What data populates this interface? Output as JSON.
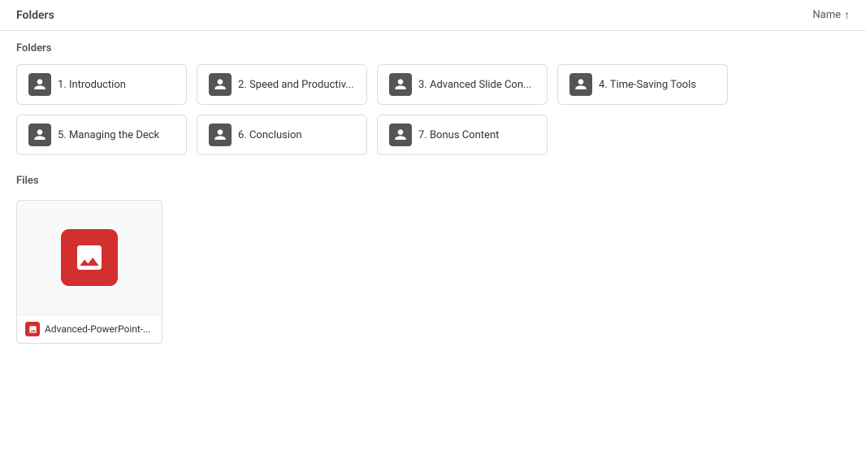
{
  "topbar": {
    "title": "Folders",
    "sort_label": "Name",
    "sort_direction": "↑"
  },
  "folders": [
    {
      "id": 1,
      "name": "1. Introduction"
    },
    {
      "id": 2,
      "name": "2. Speed and Productiv..."
    },
    {
      "id": 3,
      "name": "3. Advanced Slide Con..."
    },
    {
      "id": 4,
      "name": "4. Time-Saving Tools"
    },
    {
      "id": 5,
      "name": "5. Managing the Deck"
    },
    {
      "id": 6,
      "name": "6. Conclusion"
    },
    {
      "id": 7,
      "name": "7. Bonus Content"
    }
  ],
  "files_label": "Files",
  "files": [
    {
      "id": 1,
      "name": "Advanced-PowerPoint-..."
    }
  ]
}
